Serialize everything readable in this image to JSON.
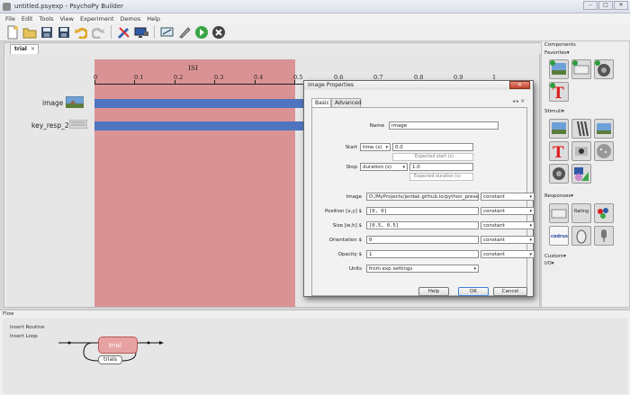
{
  "window": {
    "title": "untitled.psyexp - PsychoPy Builder",
    "controls": [
      "–",
      "□",
      "✕"
    ]
  },
  "menu": [
    "File",
    "Edit",
    "Tools",
    "View",
    "Experiment",
    "Demos",
    "Help"
  ],
  "toolbar": [
    "new-file-icon",
    "open-folder-icon",
    "save-icon",
    "save-as-icon",
    "undo-icon",
    "redo-icon",
    "preferences-icon",
    "monitor-center-icon",
    "compile-script-icon",
    "run-icon",
    "stop-icon"
  ],
  "routine": {
    "tab_label": "trial",
    "tab_close": "✕",
    "band_label": "ISI",
    "ticks": [
      "0",
      "0.1",
      "0.2",
      "0.3",
      "0.4",
      "0.5",
      "0.6",
      "0.7",
      "0.8",
      "0.9",
      "1"
    ],
    "components": [
      {
        "name": "image"
      },
      {
        "name": "key_resp_2"
      }
    ]
  },
  "components_panel": {
    "title": "Components",
    "favorites_label": "Favorites▾",
    "stimuli_label": "Stimuli▾",
    "responses_label": "Responses▾",
    "custom_label": "Custom▾",
    "io_label": "I/O▾",
    "rating_label": "Rating",
    "cedrus_label": "cedrus"
  },
  "dialog": {
    "title": "Image Properties",
    "close": "✕",
    "tabs": [
      "Basic",
      "Advanced"
    ],
    "tab_arrows": "◂ ▸ ✕",
    "name_label": "Name",
    "name_value": "image",
    "start_label": "Start",
    "start_type": "time (s)",
    "start_value": "0.0",
    "start_hint": "Expected start (s)",
    "stop_label": "Stop",
    "stop_type": "duration (s)",
    "stop_value": "1.0",
    "stop_hint": "Expected duration (s)",
    "fields": [
      {
        "label": "Image",
        "value": "D:/MyProjects/jerdak.github.io/python_presentatio",
        "update": "constant"
      },
      {
        "label": "Position [x,y] $",
        "value": "[0, 0]",
        "update": "constant"
      },
      {
        "label": "Size [w,h] $",
        "value": "[0.5, 0.5]",
        "update": "constant"
      },
      {
        "label": "Orientation $",
        "value": "0",
        "update": "constant"
      },
      {
        "label": "Opacity $",
        "value": "1",
        "update": "constant"
      }
    ],
    "units_label": "Units",
    "units_value": "from exp settings",
    "buttons": {
      "help": "Help",
      "ok": "OK",
      "cancel": "Cancel"
    }
  },
  "flow": {
    "title": "Flow",
    "insert_routine": "Insert Routine",
    "insert_loop": "Insert Loop",
    "routine_name": "trial",
    "loop_name": "trials"
  },
  "colors": {
    "isi_band": "#d8888a",
    "bar": "#4f75c0",
    "routine_box": "#e7a3a3"
  }
}
